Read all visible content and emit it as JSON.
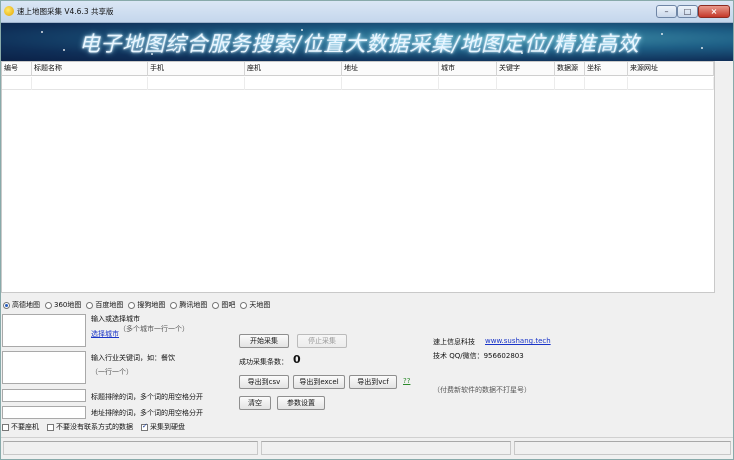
{
  "window": {
    "title": "速上地图采集 V4.6.3 共享版",
    "min_symbol": "–",
    "max_symbol": "□",
    "close_symbol": "×"
  },
  "banner": {
    "text": "电子地图综合服务搜索/位置大数据采集/地图定位/精准高效"
  },
  "table": {
    "columns": [
      "编号",
      "标题名称",
      "手机",
      "座机",
      "地址",
      "城市",
      "关键字",
      "数据源",
      "坐标",
      "来源网址"
    ]
  },
  "map_sources": {
    "options": [
      "高德地图",
      "360地图",
      "百度地图",
      "搜狗地图",
      "腾讯地图",
      "图吧",
      "天地图"
    ],
    "selected": "高德地图"
  },
  "city": {
    "label": "输入或选择城市",
    "select_link": "选择城市",
    "hint": "（多个城市一行一个）"
  },
  "keyword": {
    "label": "输入行业关键词，如：餐饮",
    "hint": "（一行一个）"
  },
  "filters": {
    "title_exclude": "标题排除的词，多个词的用空格分开",
    "address_exclude": "地址排除的词，多个词的用空格分开"
  },
  "actions": {
    "start": "开始采集",
    "stop": "停止采集",
    "success_label": "成功采集条数：",
    "count": "0",
    "export_csv": "导出到csv",
    "export_excel": "导出到excel",
    "export_vcf": "导出到vcf",
    "help_link": "??",
    "clear": "清空",
    "settings": "参数设置"
  },
  "info": {
    "company": "速上信息科技",
    "website": "www.sushang.tech",
    "contact": "技术 QQ/微信：956602803",
    "note": "（付费新软件的数据不打星号）"
  },
  "options": {
    "no_landline": "不要座机",
    "no_contact": "不要没有联系方式的数据",
    "save_to_disk": "采集到硬盘"
  },
  "options_state": {
    "no_landline": false,
    "no_contact": false,
    "save_to_disk": true
  },
  "colors": {
    "banner_dark": "#0b2147",
    "banner_glow": "#3f8fa8",
    "link": "#1a35c8",
    "close_button": "#c4382a"
  }
}
